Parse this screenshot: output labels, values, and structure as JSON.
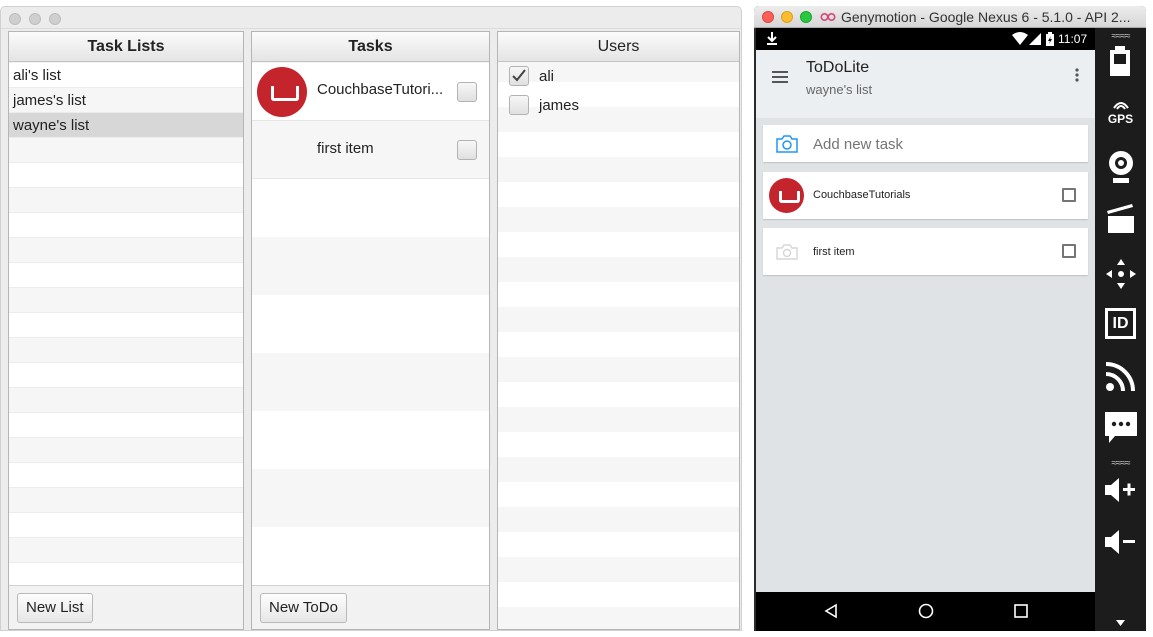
{
  "desktop": {
    "tasklists": {
      "header": "Task Lists",
      "items": [
        "ali's list",
        "james's list",
        "wayne's list"
      ],
      "selected_index": 2,
      "new_button": "New List"
    },
    "tasks": {
      "header": "Tasks",
      "items": [
        {
          "title": "CouchbaseTutori...",
          "has_image": true,
          "checked": false
        },
        {
          "title": "first item",
          "has_image": false,
          "checked": false
        }
      ],
      "new_button": "New ToDo"
    },
    "users": {
      "header": "Users",
      "items": [
        {
          "name": "ali",
          "checked": true
        },
        {
          "name": "james",
          "checked": false
        }
      ]
    }
  },
  "emulator": {
    "window_title": "Genymotion - Google Nexus 6 - 5.1.0 - API 2...",
    "status_time": "11:07",
    "app": {
      "title": "ToDoLite",
      "subtitle": "wayne's list",
      "add_placeholder": "Add new task",
      "tasks": [
        {
          "title": "CouchbaseTutorials",
          "has_image": true,
          "checked": false
        },
        {
          "title": "first item",
          "has_image": false,
          "checked": false
        }
      ]
    },
    "sidebar": {
      "gps_label": "GPS",
      "id_label": "ID"
    }
  },
  "colors": {
    "couchbase_red": "#c4242b",
    "camera_blue": "#2196f3",
    "selection_gray": "#d7d7d7"
  }
}
